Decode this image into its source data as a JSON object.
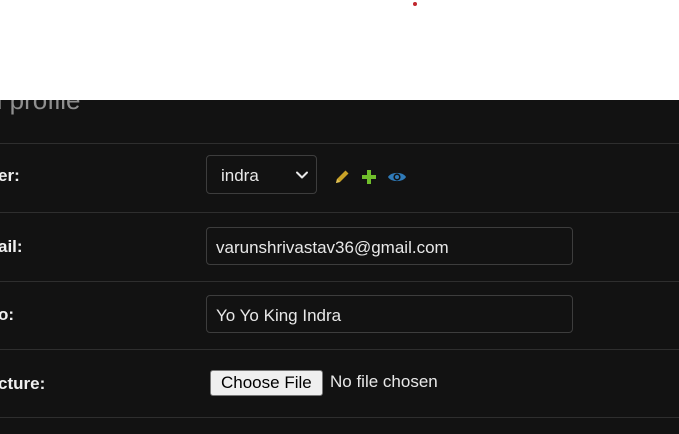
{
  "page": {
    "heading": "u profile"
  },
  "colors": {
    "background_dark": "#121212",
    "row_border": "#2e2e2e",
    "edit_icon": "#c9a227",
    "add_icon": "#70bf2b",
    "view_icon": "#2f7ab8",
    "red_dot": "#c0262d"
  },
  "form": {
    "user": {
      "label": "er:",
      "selected": "indra",
      "actions": [
        "pencil-icon",
        "plus-icon",
        "eye-icon"
      ]
    },
    "email": {
      "label": "ail:",
      "value": "varunshrivastav36@gmail.com"
    },
    "bio": {
      "label": "o:",
      "value": "Yo Yo King Indra"
    },
    "picture": {
      "label": "cture:",
      "button_label": "Choose File",
      "status": "No file chosen"
    }
  }
}
